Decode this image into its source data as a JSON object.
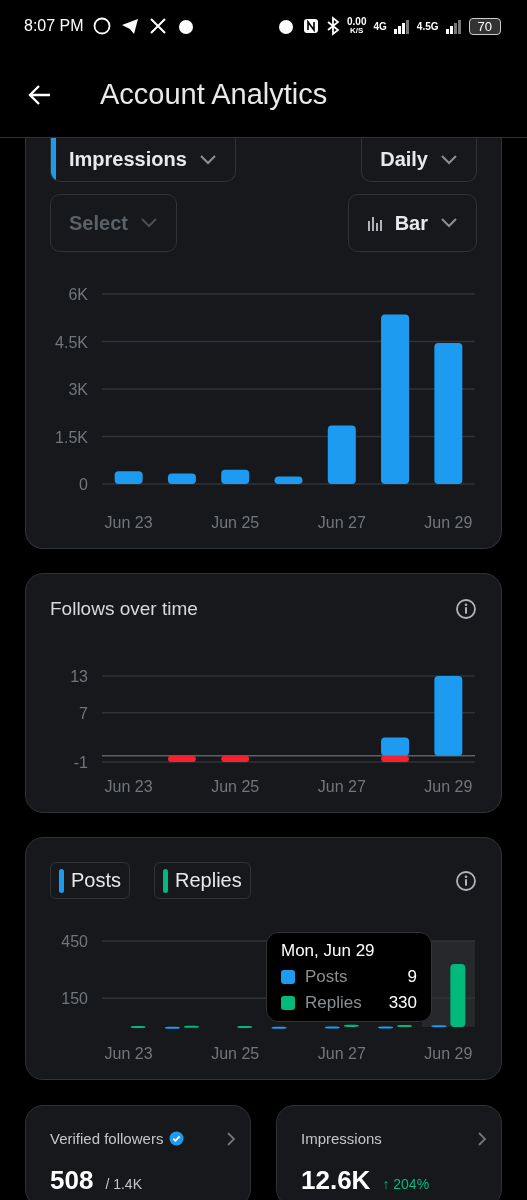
{
  "status_bar": {
    "time": "8:07 PM",
    "net_speed": "0.00",
    "net_unit": "K/S",
    "sim1": "4G",
    "sim2": "4.5G",
    "battery": "70"
  },
  "header": {
    "title": "Account Analytics"
  },
  "impressions_card": {
    "filters": [
      {
        "label": "Impressions",
        "kind": "metric",
        "disabled": false
      },
      {
        "label": "Daily",
        "kind": "plain",
        "disabled": false
      },
      {
        "label": "Select",
        "kind": "plain",
        "disabled": true
      },
      {
        "label": "Bar",
        "kind": "chart",
        "disabled": false
      }
    ],
    "chart_data": {
      "type": "bar",
      "grid": true,
      "categories": [
        "Jun 23",
        null,
        "Jun 25",
        null,
        "Jun 27",
        null,
        "Jun 29"
      ],
      "series": [
        {
          "color": "#1d9bf0",
          "values": [
            400,
            330,
            450,
            240,
            1850,
            5350,
            4450
          ]
        }
      ],
      "ylim": [
        0,
        6000
      ],
      "yticks": [
        {
          "value": 0,
          "label": "0"
        },
        {
          "value": 1500,
          "label": "1.5K"
        },
        {
          "value": 3000,
          "label": "3K"
        },
        {
          "value": 4500,
          "label": "4.5K"
        },
        {
          "value": 6000,
          "label": "6K"
        }
      ]
    }
  },
  "follows_card": {
    "title": "Follows over time",
    "chart_data": {
      "type": "bar",
      "grid": true,
      "stacked": true,
      "categories": [
        "Jun 23",
        null,
        "Jun 25",
        null,
        "Jun 27",
        null,
        "Jun 29"
      ],
      "series": [
        {
          "color": "#1d9bf0",
          "values": [
            0,
            0,
            0,
            0,
            0,
            3,
            13
          ]
        },
        {
          "color": "#f4212e",
          "values": [
            0,
            -1,
            -1,
            0,
            0,
            -1,
            0
          ]
        }
      ],
      "ylim": [
        -1,
        13
      ],
      "yticks": [
        {
          "value": -1,
          "label": "-1"
        },
        {
          "value": 7,
          "label": "7"
        },
        {
          "value": 13,
          "label": "13"
        }
      ]
    }
  },
  "posts_card": {
    "legend": [
      {
        "label": "Posts",
        "color": "#1d9bf0"
      },
      {
        "label": "Replies",
        "color": "#00ba7c"
      }
    ],
    "tooltip": {
      "title": "Mon, Jun 29",
      "rows": [
        {
          "label": "Posts",
          "value": "9",
          "color": "#1d9bf0"
        },
        {
          "label": "Replies",
          "value": "330",
          "color": "#00ba7c"
        }
      ]
    },
    "chart_data": {
      "type": "bar",
      "grid": true,
      "categories": [
        "Jun 23",
        null,
        "Jun 25",
        null,
        "Jun 27",
        null,
        "Jun 29"
      ],
      "series": [
        {
          "color": "#1d9bf0",
          "values": [
            0,
            1,
            0,
            1,
            3,
            2,
            9
          ]
        },
        {
          "color": "#00ba7c",
          "values": [
            5,
            6,
            5,
            0,
            12,
            10,
            330
          ]
        }
      ],
      "ylim": [
        0,
        450
      ],
      "yticks": [
        {
          "value": 150,
          "label": "150"
        },
        {
          "value": 450,
          "label": "450"
        }
      ]
    }
  },
  "stat_cards": [
    {
      "title": "Verified followers",
      "verified": true,
      "value": "508",
      "sub": "/ 1.4K"
    },
    {
      "title": "Impressions",
      "verified": false,
      "value": "12.6K",
      "sub": "↑ 204%"
    }
  ]
}
